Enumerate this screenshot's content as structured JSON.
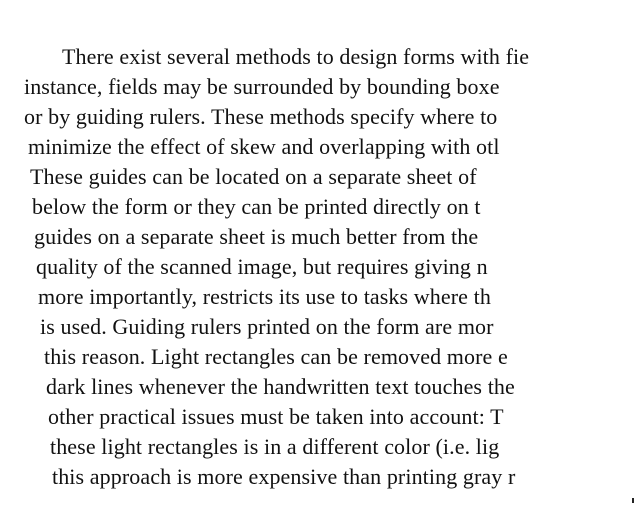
{
  "document": {
    "lines": [
      "There exist several methods to design forms with fie",
      "instance, fields may be surrounded by bounding boxe",
      "or by guiding rulers. These methods specify where to",
      "minimize the effect of skew and overlapping with otl",
      "These guides can be located on a separate sheet of",
      "below the form or they can be printed directly on t",
      "guides on a separate sheet is much better from the",
      "quality of the scanned image, but requires giving n",
      "more importantly, restricts its use to tasks where th",
      "is used. Guiding rulers printed on the form are mor",
      "this reason. Light rectangles can be removed more e",
      "dark lines whenever the handwritten text touches the",
      "other practical issues must be taken into account: T",
      "these light rectangles is in a different color (i.e. lig",
      "this approach is more expensive than printing gray r"
    ]
  }
}
